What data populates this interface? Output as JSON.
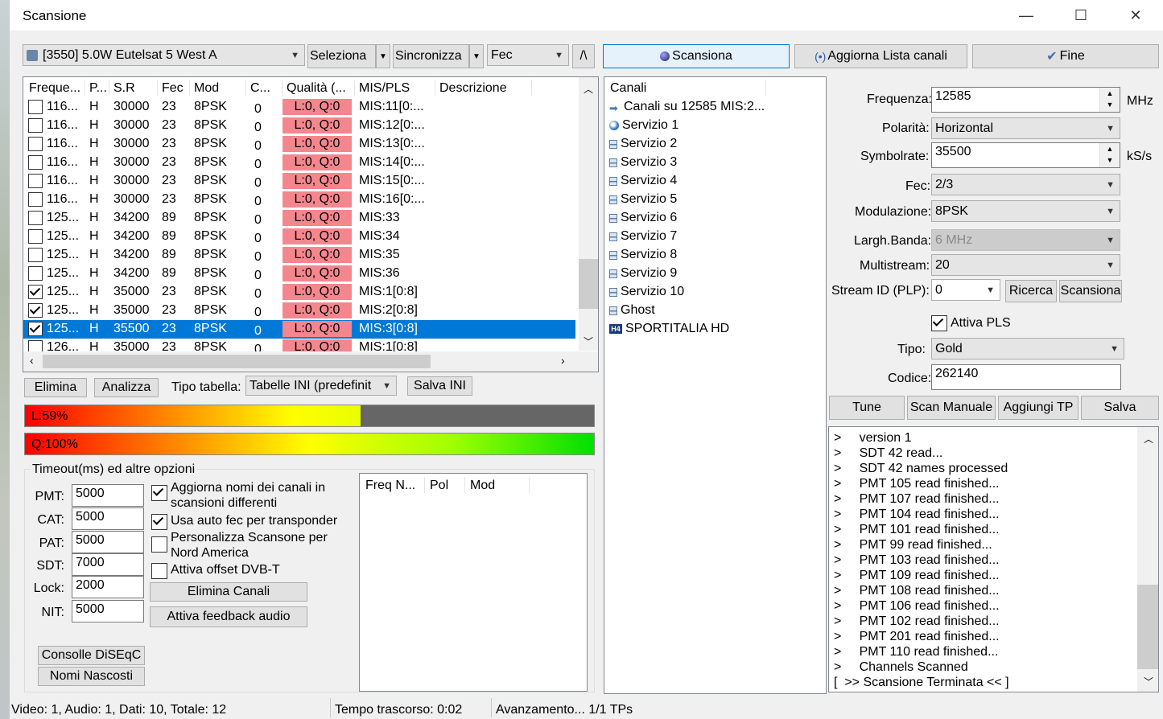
{
  "window": {
    "title": "Scansione",
    "minimize": "—",
    "maximize": "☐",
    "close": "✕"
  },
  "top": {
    "satellite": "[3550]   5.0W  Eutelsat 5 West A",
    "seleziona": "Seleziona",
    "sincronizza": "Sincronizza",
    "fec": "Fec",
    "caret": "/\\",
    "scansiona": "Scansiona",
    "aggiorna": "Aggiorna Lista canali",
    "fine": "Fine"
  },
  "grid": {
    "headers": [
      "Freque...",
      "P...",
      "S.R",
      "Fec",
      "Mod",
      "C...",
      "Qualità (...",
      "MIS/PLS",
      "Descrizione"
    ],
    "rows": [
      {
        "checked": false,
        "freq": "116...",
        "pol": "H",
        "sr": "30000",
        "fec": "23",
        "mod": "8PSK",
        "c": "0",
        "q": "L:0, Q:0",
        "mis": "MIS:11[0:..."
      },
      {
        "checked": false,
        "freq": "116...",
        "pol": "H",
        "sr": "30000",
        "fec": "23",
        "mod": "8PSK",
        "c": "0",
        "q": "L:0, Q:0",
        "mis": "MIS:12[0:..."
      },
      {
        "checked": false,
        "freq": "116...",
        "pol": "H",
        "sr": "30000",
        "fec": "23",
        "mod": "8PSK",
        "c": "0",
        "q": "L:0, Q:0",
        "mis": "MIS:13[0:..."
      },
      {
        "checked": false,
        "freq": "116...",
        "pol": "H",
        "sr": "30000",
        "fec": "23",
        "mod": "8PSK",
        "c": "0",
        "q": "L:0, Q:0",
        "mis": "MIS:14[0:..."
      },
      {
        "checked": false,
        "freq": "116...",
        "pol": "H",
        "sr": "30000",
        "fec": "23",
        "mod": "8PSK",
        "c": "0",
        "q": "L:0, Q:0",
        "mis": "MIS:15[0:..."
      },
      {
        "checked": false,
        "freq": "116...",
        "pol": "H",
        "sr": "30000",
        "fec": "23",
        "mod": "8PSK",
        "c": "0",
        "q": "L:0, Q:0",
        "mis": "MIS:16[0:..."
      },
      {
        "checked": false,
        "freq": "125...",
        "pol": "H",
        "sr": "34200",
        "fec": "89",
        "mod": "8PSK",
        "c": "0",
        "q": "L:0, Q:0",
        "mis": "MIS:33"
      },
      {
        "checked": false,
        "freq": "125...",
        "pol": "H",
        "sr": "34200",
        "fec": "89",
        "mod": "8PSK",
        "c": "0",
        "q": "L:0, Q:0",
        "mis": "MIS:34"
      },
      {
        "checked": false,
        "freq": "125...",
        "pol": "H",
        "sr": "34200",
        "fec": "89",
        "mod": "8PSK",
        "c": "0",
        "q": "L:0, Q:0",
        "mis": "MIS:35"
      },
      {
        "checked": false,
        "freq": "125...",
        "pol": "H",
        "sr": "34200",
        "fec": "89",
        "mod": "8PSK",
        "c": "0",
        "q": "L:0, Q:0",
        "mis": "MIS:36"
      },
      {
        "checked": true,
        "freq": "125...",
        "pol": "H",
        "sr": "35000",
        "fec": "23",
        "mod": "8PSK",
        "c": "0",
        "q": "L:0, Q:0",
        "mis": "MIS:1[0:8]"
      },
      {
        "checked": true,
        "freq": "125...",
        "pol": "H",
        "sr": "35000",
        "fec": "23",
        "mod": "8PSK",
        "c": "0",
        "q": "L:0, Q:0",
        "mis": "MIS:2[0:8]"
      },
      {
        "checked": true,
        "freq": "125...",
        "pol": "H",
        "sr": "35500",
        "fec": "23",
        "mod": "8PSK",
        "c": "0",
        "q": "L:0, Q:0",
        "mis": "MIS:3[0:8]",
        "selected": true
      },
      {
        "checked": false,
        "freq": "126...",
        "pol": "H",
        "sr": "35000",
        "fec": "23",
        "mod": "8PSK",
        "c": "0",
        "q": "L:0, Q:0",
        "mis": "MIS:1[0:8]"
      }
    ]
  },
  "grid_buttons": {
    "elimina": "Elimina",
    "analizza": "Analizza",
    "tipo_label": "Tipo tabella:",
    "tipo_value": "Tabelle INI (predefinit",
    "salva_ini": "Salva INI"
  },
  "bars": {
    "level_label": "L:59%",
    "level": 0.59,
    "quality_label": "Q:100%",
    "quality": 1.0
  },
  "options": {
    "group": "Timeout(ms) ed altre opzioni",
    "fields": [
      {
        "label": "PMT:",
        "value": "5000"
      },
      {
        "label": "CAT:",
        "value": "5000"
      },
      {
        "label": "PAT:",
        "value": "5000"
      },
      {
        "label": "SDT:",
        "value": "7000"
      },
      {
        "label": "Lock:",
        "value": "2000"
      },
      {
        "label": "NIT:",
        "value": "5000"
      }
    ],
    "chk1": "Aggiorna nomi dei canali in\nscansioni differenti",
    "chk1_on": true,
    "chk2": "Usa auto fec per transponder",
    "chk2_on": true,
    "chk3": "Personalizza Scansone per\nNord America",
    "chk3_on": false,
    "chk4": "Attiva offset DVB-T",
    "chk4_on": false,
    "elimina_canali": "Elimina Canali",
    "feedback": "Attiva feedback audio",
    "diseqc": "Consolle DiSEqC",
    "nascosti": "Nomi Nascosti",
    "mini_headers": [
      "Freq N...",
      "Pol",
      "Mod"
    ]
  },
  "tree": {
    "header": "Canali",
    "items": [
      {
        "label": "Canali su 12585 MIS:2...",
        "icon": "arrow-right-icon"
      },
      {
        "label": "Servizio 1",
        "icon": "globe-icon"
      },
      {
        "label": "Servizio 2",
        "icon": "tv-icon"
      },
      {
        "label": "Servizio 3",
        "icon": "tv-icon"
      },
      {
        "label": "Servizio 4",
        "icon": "tv-icon"
      },
      {
        "label": "Servizio 5",
        "icon": "tv-icon"
      },
      {
        "label": "Servizio 6",
        "icon": "tv-icon"
      },
      {
        "label": "Servizio 7",
        "icon": "tv-icon"
      },
      {
        "label": "Servizio 8",
        "icon": "tv-icon"
      },
      {
        "label": "Servizio 9",
        "icon": "tv-icon"
      },
      {
        "label": "Servizio 10",
        "icon": "tv-icon"
      },
      {
        "label": "Ghost",
        "icon": "tv-icon"
      },
      {
        "label": "SPORTITALIA HD",
        "icon": "h4-icon"
      }
    ]
  },
  "params": {
    "freq_label": "Frequenza:",
    "freq": "12585",
    "mhz": "MHz",
    "pol_label": "Polarità:",
    "pol": "Horizontal",
    "sr_label": "Symbolrate:",
    "sr": "35500",
    "ks": "kS/s",
    "fec_label": "Fec:",
    "fec": "2/3",
    "mod_label": "Modulazione:",
    "mod": "8PSK",
    "bw_label": "Largh.Banda:",
    "bw": "6 MHz",
    "ms_label": "Multistream:",
    "ms": "20",
    "sid_label": "Stream ID (PLP):",
    "sid": "0",
    "ricerca": "Ricerca",
    "scansiona": "Scansiona",
    "pls_label": "Attiva PLS",
    "tipo_label": "Tipo:",
    "tipo": "Gold",
    "codice_label": "Codice:",
    "codice": "262140",
    "tune": "Tune",
    "scan_manuale": "Scan Manuale",
    "aggiungi_tp": "Aggiungi TP",
    "salva": "Salva"
  },
  "log": [
    ">     version 1",
    ">     SDT 42 read...",
    ">     SDT 42 names processed",
    ">     PMT 105 read finished...",
    ">     PMT 107 read finished...",
    ">     PMT 104 read finished...",
    ">     PMT 101 read finished...",
    ">     PMT 99 read finished...",
    ">     PMT 103 read finished...",
    ">     PMT 109 read finished...",
    ">     PMT 108 read finished...",
    ">     PMT 106 read finished...",
    ">     PMT 102 read finished...",
    ">     PMT 201 read finished...",
    ">     PMT 110 read finished...",
    ">     Channels Scanned",
    "[  >> Scansione Terminata << ]"
  ],
  "status": {
    "counts": "Video: 1, Audio: 1, Dati: 10, Totale: 12",
    "time": "Tempo trascorso: 0:02",
    "progress": "Avanzamento... 1/1 TPs"
  }
}
